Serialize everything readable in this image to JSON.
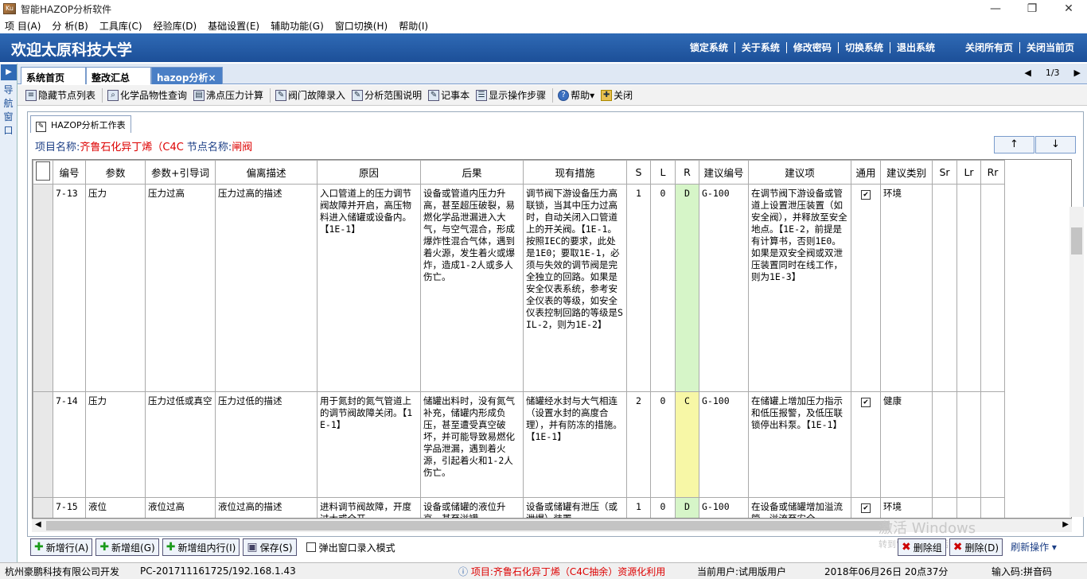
{
  "window": {
    "title": "智能HAZOP分析软件",
    "icon_text": "Ku"
  },
  "menu": [
    "项 目(A)",
    "分 析(B)",
    "工具库(C)",
    "经验库(D)",
    "基础设置(E)",
    "辅助功能(G)",
    "窗口切换(H)",
    "帮助(I)"
  ],
  "banner": {
    "welcome": "欢迎太原科技大学",
    "links": [
      "锁定系统",
      "关于系统",
      "修改密码",
      "切换系统",
      "退出系统"
    ],
    "right_links": [
      "关闭所有页",
      "关闭当前页"
    ]
  },
  "nav": {
    "label": "导航窗口"
  },
  "tabs": [
    {
      "label": "系统首页",
      "active": false
    },
    {
      "label": "整改汇总",
      "active": false
    },
    {
      "label": "hazop分析×",
      "active": true
    }
  ],
  "pager": {
    "text": "1/3"
  },
  "toolbar": [
    {
      "label": "隐藏节点列表",
      "icon": "list-icon"
    },
    {
      "label": "化学品物性查询",
      "icon": "search-icon"
    },
    {
      "label": "沸点压力计算",
      "icon": "calc-icon"
    },
    {
      "label": "阀门故障录入",
      "icon": "edit-icon"
    },
    {
      "label": "分析范围说明",
      "icon": "edit-icon"
    },
    {
      "label": "记事本",
      "icon": "notepad-icon"
    },
    {
      "label": "显示操作步骤",
      "icon": "steps-icon"
    },
    {
      "label": "帮助▾",
      "icon": "help-icon"
    },
    {
      "label": "关闭",
      "icon": "close-icon"
    }
  ],
  "workspace": {
    "tab_label": "HAZOP分析工作表",
    "project_label": "项目名称:",
    "project_value": "齐鲁石化异丁烯（C4C",
    "node_label": "节点名称:",
    "node_value": "闸阀",
    "up_btn": "↑",
    "down_btn": "↓"
  },
  "grid": {
    "columns": [
      "编号",
      "参数",
      "参数+引导词",
      "偏离描述",
      "原因",
      "后果",
      "现有措施",
      "S",
      "L",
      "R",
      "建议编号",
      "建议项",
      "通用",
      "建议类别",
      "Sr",
      "Lr",
      "Rr"
    ],
    "rows": [
      {
        "id": "7-13",
        "param": "压力",
        "guide": "压力过高",
        "deviation": "压力过高的描述",
        "cause": "入口管道上的压力调节阀故障并开启，高压物料进入储罐或设备内。【1E-1】",
        "consequence": "设备或管道内压力升高，甚至超压破裂，易燃化学品泄漏进入大气，与空气混合，形成爆炸性混合气体，遇到着火源，发生着火或爆炸，造成1-2人或多人伤亡。",
        "measures": "调节阀下游设备压力高联锁，当其中压力过高时，自动关闭入口管道上的开关阀。【1E-1。按照IEC的要求，此处是1E0；要取1E-1，必须与失效的调节阀是完全独立的回路。如果是安全仪表系统，参考安全仪表的等级，如安全仪表控制回路的等级是SIL-2，则为1E-2】",
        "S": "1",
        "L": "0",
        "R": "D",
        "R_color": "green",
        "sug_id": "G-100",
        "suggestion": "在调节阀下游设备或管道上设置泄压装置（如安全阀），并释放至安全地点。【1E-2，前提是有计算书，否则1E0。如果是双安全阀或双泄压装置同时在线工作，则为1E-3】",
        "common": "✔",
        "category": "环境",
        "Sr": "",
        "Lr": "",
        "Rr": ""
      },
      {
        "id": "7-14",
        "param": "压力",
        "guide": "压力过低或真空",
        "deviation": "压力过低的描述",
        "cause": "用于氮封的氮气管道上的调节阀故障关闭。【1E-1】",
        "consequence": "储罐出料时，没有氮气补充，储罐内形成负压，甚至遭受真空破坏，并可能导致易燃化学品泄漏，遇到着火源，引起着火和1-2人伤亡。",
        "measures": "储罐经水封与大气相连 （设置水封的高度合理），并有防冻的措施。【1E-1】",
        "S": "2",
        "L": "0",
        "R": "C",
        "R_color": "yellow",
        "sug_id": "G-100",
        "suggestion": "在储罐上增加压力指示和低压报警，及低压联锁停出料泵。【1E-1】",
        "common": "✔",
        "category": "健康",
        "Sr": "",
        "Lr": "",
        "Rr": ""
      },
      {
        "id": "7-15",
        "param": "液位",
        "guide": "液位过高",
        "deviation": "液位过高的描述",
        "cause": "进料调节阀故障，开度过大或全开",
        "consequence": "设备或储罐的液位升高，甚至溢罐",
        "measures": "设备或储罐有泄压（或泄爆）装置",
        "S": "1",
        "L": "0",
        "R": "D",
        "R_color": "green",
        "sug_id": "G-100",
        "suggestion": "在设备或储罐增加溢流管，溢流至安全",
        "common": "✔",
        "category": "环境",
        "Sr": "",
        "Lr": "",
        "Rr": ""
      }
    ]
  },
  "bottom_buttons": [
    {
      "label": "新增行(A)",
      "icon": "plus-icon"
    },
    {
      "label": "新增组(G)",
      "icon": "plus-icon"
    },
    {
      "label": "新增组内行(I)",
      "icon": "plus-icon"
    },
    {
      "label": "保存(S)",
      "icon": "save-icon"
    }
  ],
  "popup_checkbox": {
    "label": "弹出窗口录入模式",
    "checked": false
  },
  "delete_buttons": [
    {
      "label": "删除组"
    },
    {
      "label": "删除(D)"
    }
  ],
  "refresh": {
    "label": "刷新操作 ▾"
  },
  "watermark": {
    "line1": "激活 Windows",
    "line2": "转到“设置”以激活 Windows。"
  },
  "status": {
    "company": "杭州豪鹏科技有限公司开发",
    "host": "PC-201711161725/192.168.1.43",
    "project": "项目:齐鲁石化异丁烯（C4C抽余）资源化利用",
    "user": "当前用户:试用版用户",
    "datetime": "2018年06月26日 20点37分",
    "ime": "输入码:拼音码"
  }
}
